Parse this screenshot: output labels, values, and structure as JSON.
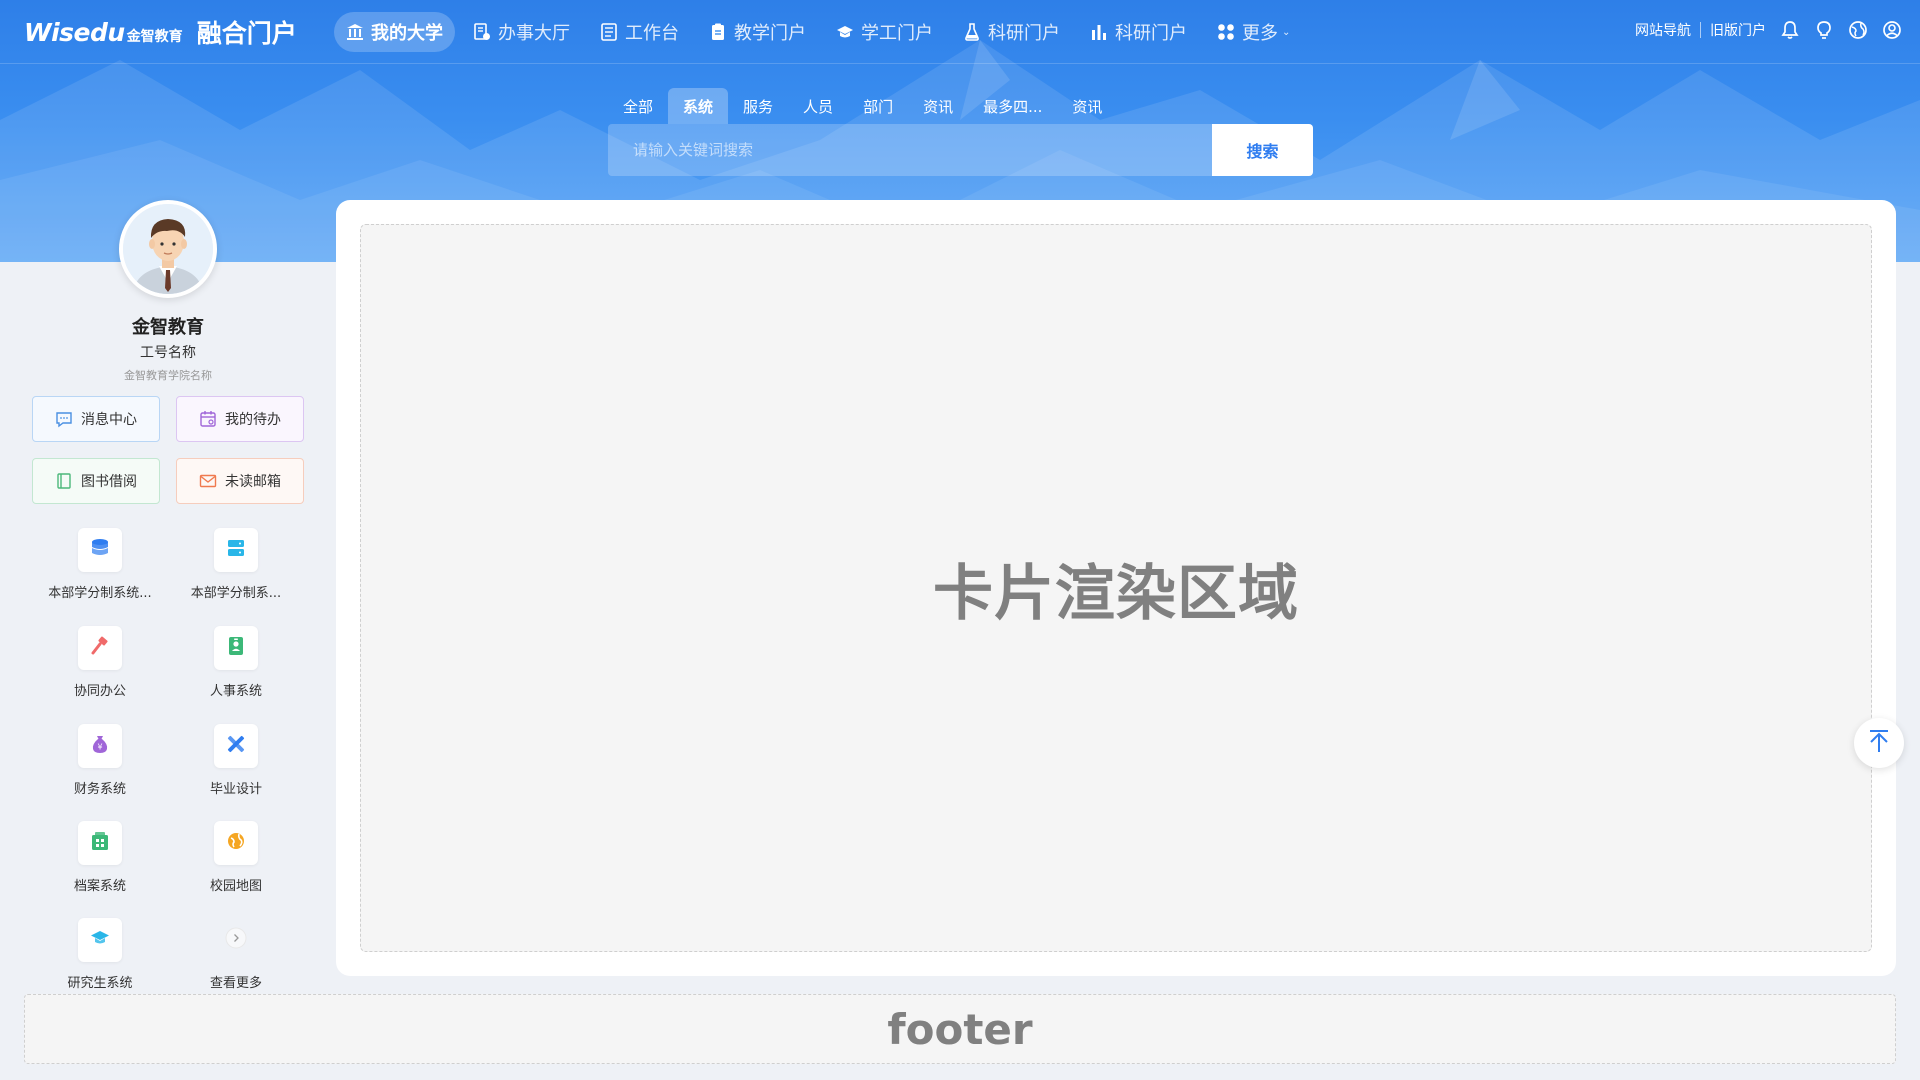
{
  "header": {
    "brand": "Wisedu",
    "brand_cn": "金智教育",
    "portal_title": "融合门户",
    "nav": [
      {
        "label": "我的大学",
        "icon": "bank-icon",
        "active": true
      },
      {
        "label": "办事大厅",
        "icon": "service-hall-icon"
      },
      {
        "label": "工作台",
        "icon": "workbench-icon"
      },
      {
        "label": "教学门户",
        "icon": "clipboard-icon"
      },
      {
        "label": "学工门户",
        "icon": "graduation-cap-icon"
      },
      {
        "label": "科研门户",
        "icon": "flask-icon"
      },
      {
        "label": "科研门户",
        "icon": "bar-chart-icon"
      },
      {
        "label": "更多",
        "icon": "grid-icon"
      }
    ],
    "site_nav": "网站导航",
    "old_portal": "旧版门户"
  },
  "search": {
    "tabs": [
      "全部",
      "系统",
      "服务",
      "人员",
      "部门",
      "资讯",
      "最多四...",
      "资讯"
    ],
    "active_tab": 1,
    "placeholder": "请输入关键词搜索",
    "button": "搜索"
  },
  "user": {
    "name": "金智教育",
    "id_label": "工号名称",
    "org": "金智教育学院名称"
  },
  "quick": [
    {
      "label": "消息中心",
      "icon": "message-icon",
      "color": "#4a90e2",
      "border": "#b9d6f5",
      "bg": "#f5f9fe"
    },
    {
      "label": "我的待办",
      "icon": "calendar-icon",
      "color": "#a066d8",
      "border": "#dcc6f2",
      "bg": "#faf6fe"
    },
    {
      "label": "图书借阅",
      "icon": "book-icon",
      "color": "#4cb87a",
      "border": "#c3e7d1",
      "bg": "#f5fbf7"
    },
    {
      "label": "未读邮箱",
      "icon": "mail-icon",
      "color": "#f07a4f",
      "border": "#f6cdbd",
      "bg": "#fef8f5"
    }
  ],
  "apps": [
    {
      "label": "本部学分制系统...",
      "icon": "database-icon"
    },
    {
      "label": "本部学分制系...",
      "icon": "server-icon"
    },
    {
      "label": "协同办公",
      "icon": "hammer-icon"
    },
    {
      "label": "人事系统",
      "icon": "id-badge-icon"
    },
    {
      "label": "财务系统",
      "icon": "money-bag-icon"
    },
    {
      "label": "毕业设计",
      "icon": "design-tools-icon"
    },
    {
      "label": "档案系统",
      "icon": "archive-icon"
    },
    {
      "label": "校园地图",
      "icon": "globe-icon"
    },
    {
      "label": "研究生系统",
      "icon": "graduate-icon"
    },
    {
      "label": "查看更多",
      "icon": "chevron-right-icon"
    }
  ],
  "card": {
    "text": "卡片渲染区域"
  },
  "footer": {
    "text": "footer"
  }
}
